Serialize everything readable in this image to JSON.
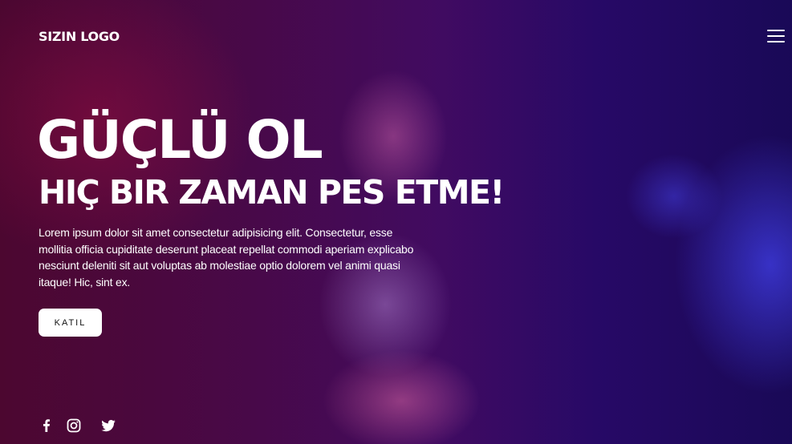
{
  "header": {
    "logo_text": "SIZIN LOGO",
    "menu_icon": "hamburger-menu-icon"
  },
  "hero": {
    "headline": "GÜÇLÜ OL",
    "subheadline": "HIÇ BIR ZAMAN PES ETME!",
    "body": "Lorem ipsum dolor sit amet consectetur adipisicing elit. Consectetur, esse mollitia officia cupiditate deserunt placeat repellat commodi aperiam explicabo nesciunt deleniti sit aut voluptas ab molestiae optio dolorem vel animi quasi itaque! Hic, sint ex.",
    "cta_label": "KATIL"
  },
  "social": {
    "icons": [
      "facebook-icon",
      "instagram-icon",
      "twitter-icon"
    ]
  },
  "colors": {
    "text": "#ffffff",
    "button_bg": "#ffffff",
    "button_text": "#111111",
    "bg_magenta": "#5a0c55",
    "bg_blue": "#2a0a70"
  }
}
